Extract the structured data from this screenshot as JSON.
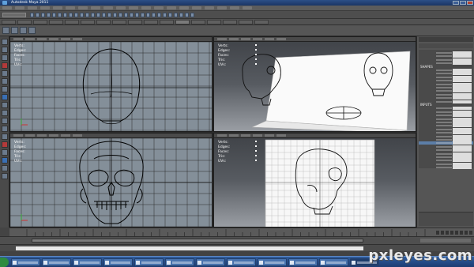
{
  "window": {
    "title": "Autodesk Maya 2011"
  },
  "viewport_hud": [
    "Verts:",
    "Edges:",
    "Faces:",
    "Tris:",
    "UVs:"
  ],
  "channel_box": {
    "sections": [
      "SHAPES",
      "INPUTS"
    ]
  },
  "watermark": "pxleyes.com",
  "taskbar_count": 12
}
